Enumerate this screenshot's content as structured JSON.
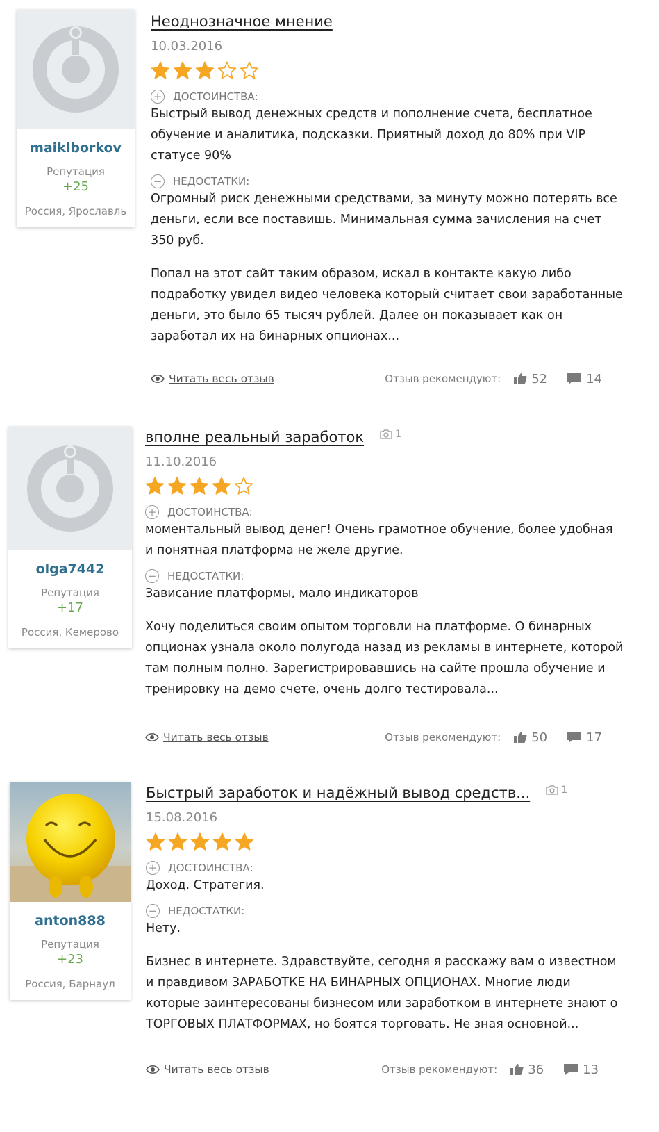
{
  "labels": {
    "reputation": "Репутация",
    "pros": "ДОСТОИНСТВА:",
    "cons": "НЕДОСТАТКИ:",
    "read_full": "Читать весь отзыв",
    "recommend": "Отзыв рекомендуют:"
  },
  "colors": {
    "star": "#f5a623",
    "username": "#2f6f8f",
    "reputation_value": "#6aa84f"
  },
  "reviews": [
    {
      "username": "maiklborkov",
      "reputation": "+25",
      "location": "Россия, Ярославль",
      "avatar": "default-avatar-icon",
      "title": "Неоднозначное мнение",
      "photos": null,
      "date": "10.03.2016",
      "rating": 3,
      "pros": "Быстрый вывод денежных средств и пополнение счета, бесплатное обучение и аналитика, подсказки. Приятный доход до 80% при VIP статусе 90%",
      "cons": "Огромный риск денежными средствами, за минуту можно потерять все деньги, если все поставишь. Минимальная сумма зачисления на счет 350 руб.",
      "text": "Попал на этот сайт таким образом, искал в контакте какую либо подработку увидел видео человека который считает свои заработанные деньги, это было 65 тысяч рублей. Далее он показывает как он заработал их на бинарных опционах...",
      "likes": "52",
      "comments": "14"
    },
    {
      "username": "olga7442",
      "reputation": "+17",
      "location": "Россия, Кемерово",
      "avatar": "default-avatar-icon",
      "title": "вполне реальный заработок",
      "photos": "1",
      "date": "11.10.2016",
      "rating": 4,
      "pros": "моментальный вывод денег! Очень грамотное обучение, более удобная и понятная платформа не желе другие.",
      "cons": "Зависание платформы, мало индикаторов",
      "text": "Хочу поделиться своим опытом торговли на платформе. О бинарных опционах узнала около полугода назад из рекламы в интернете, которой там полным полно. Зарегистрировавшись на сайте прошла обучение и тренировку на демо счете, очень долго тестировала...",
      "likes": "50",
      "comments": "17"
    },
    {
      "username": "anton888",
      "reputation": "+23",
      "location": "Россия, Барнаул",
      "avatar": "smiley-photo",
      "title": "Быстрый заработок и надёжный вывод средств...",
      "photos": "1",
      "date": "15.08.2016",
      "rating": 5,
      "pros": "Доход. Стратегия.",
      "cons": "Нету.",
      "text": "Бизнес в интернете. Здравствуйте, сегодня я расскажу вам о известном и правдивом ЗАРАБОТКЕ НА БИНАРНЫХ ОПЦИОНАХ. Многие люди которые заинтересованы бизнесом или заработком в интернете знают о ТОРГОВЫХ ПЛАТФОРМАХ, но боятся торговать. Не зная основной...",
      "likes": "36",
      "comments": "13"
    }
  ]
}
